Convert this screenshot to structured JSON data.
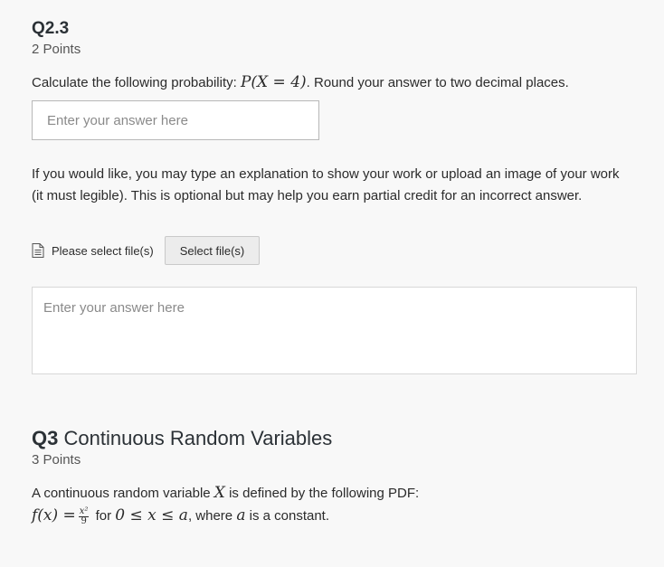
{
  "q23": {
    "title": "Q2.3",
    "points": "2 Points",
    "prompt_before": "Calculate the following probability: ",
    "prompt_math": "P(X = 4)",
    "prompt_after": ". Round your answer to two decimal places.",
    "answer_placeholder": "Enter your answer here",
    "explanation_text": "If you would like, you may type an explanation to show your work or upload an image of your work (it must legible). This is optional but may help you earn partial credit for an incorrect answer.",
    "file_label": "Please select file(s)",
    "file_button": "Select file(s)",
    "explanation_placeholder": "Enter your answer here"
  },
  "q3": {
    "number": "Q3",
    "name": "Continuous Random Variables",
    "points": "3 Points",
    "desc_before": "A continuous random variable ",
    "desc_var": "X",
    "desc_after": " is defined by the following PDF:",
    "pdf_lhs": "f(x) =",
    "pdf_num": "x²",
    "pdf_den": "9",
    "pdf_for": " for ",
    "pdf_range": "0 ≤ x ≤ a",
    "pdf_where": ", where ",
    "pdf_a": "a",
    "pdf_end": " is a constant."
  }
}
